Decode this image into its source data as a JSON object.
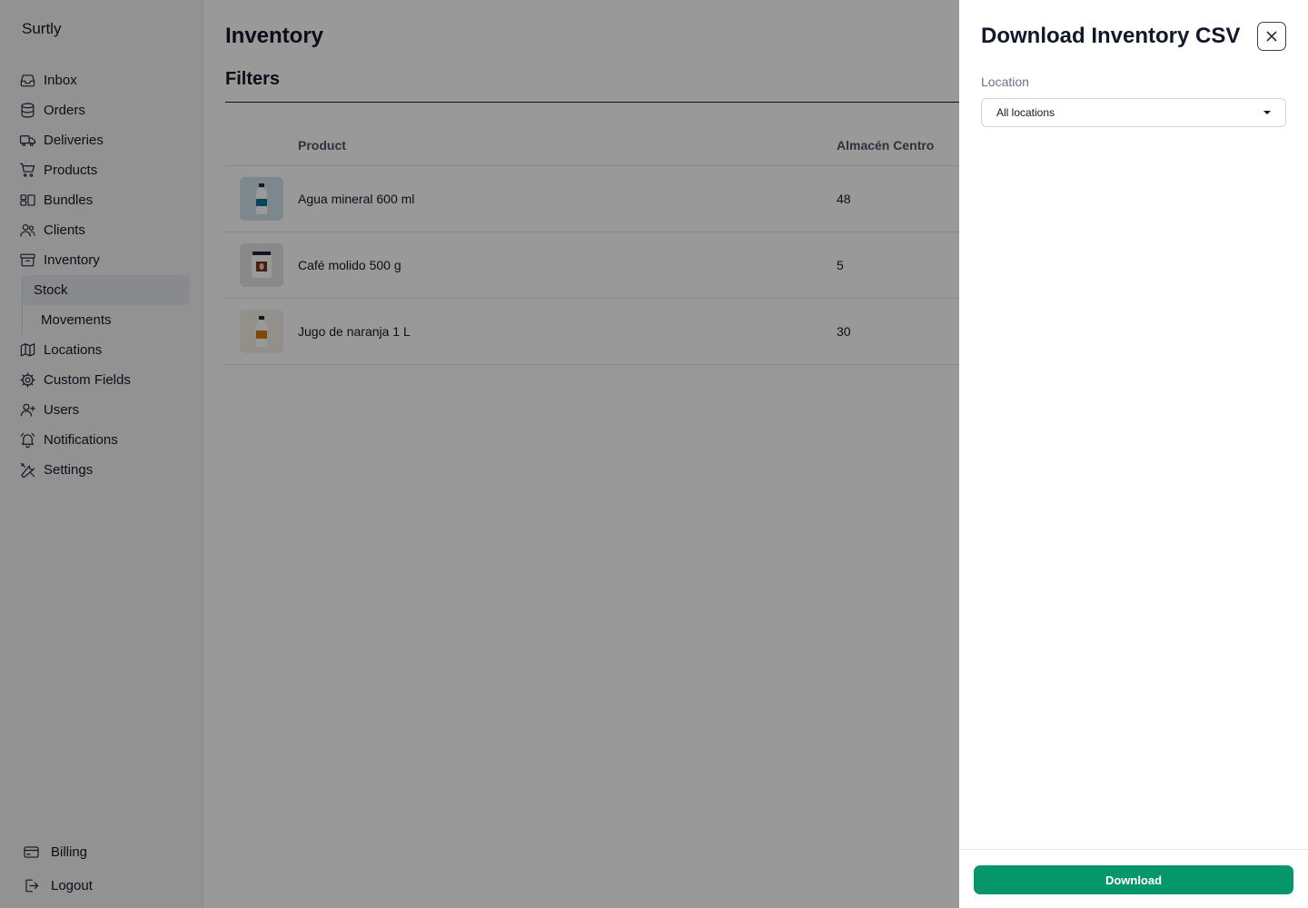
{
  "app": {
    "brand": "Surtly"
  },
  "sidebar": {
    "items": [
      {
        "label": "Inbox",
        "icon": "inbox-icon"
      },
      {
        "label": "Orders",
        "icon": "database-icon"
      },
      {
        "label": "Deliveries",
        "icon": "truck-icon"
      },
      {
        "label": "Products",
        "icon": "cart-icon"
      },
      {
        "label": "Bundles",
        "icon": "bundles-icon"
      },
      {
        "label": "Clients",
        "icon": "users-icon"
      },
      {
        "label": "Inventory",
        "icon": "archive-icon"
      }
    ],
    "subitems": [
      {
        "label": "Stock",
        "active": true
      },
      {
        "label": "Movements",
        "active": false
      }
    ],
    "items_after": [
      {
        "label": "Locations",
        "icon": "map-icon"
      },
      {
        "label": "Custom Fields",
        "icon": "cog-icon"
      },
      {
        "label": "Users",
        "icon": "user-plus-icon"
      },
      {
        "label": "Notifications",
        "icon": "bell-icon"
      },
      {
        "label": "Settings",
        "icon": "wrench-screwdriver-icon"
      }
    ],
    "bottom": [
      {
        "label": "Billing",
        "icon": "credit-card-icon"
      },
      {
        "label": "Logout",
        "icon": "logout-icon"
      }
    ]
  },
  "main": {
    "title": "Inventory",
    "filters_title": "Filters",
    "table": {
      "headers": [
        "",
        "Product",
        "Almacén Centro"
      ],
      "rows": [
        {
          "product": "Agua mineral 600 ml",
          "qty": "48",
          "thumb_bg": "#cfe3ea",
          "label_color": "#0e7490"
        },
        {
          "product": "Café molido 500 g",
          "qty": "5",
          "thumb_bg": "#e7e5e4",
          "label_color": "#78350f"
        },
        {
          "product": "Jugo de naranja 1 L",
          "qty": "30",
          "thumb_bg": "#f5efe6",
          "label_color": "#d97706"
        }
      ]
    }
  },
  "drawer": {
    "title": "Download Inventory CSV",
    "location_label": "Location",
    "location_value": "All locations",
    "download_label": "Download"
  },
  "colors": {
    "accent": "#059669",
    "overlay": "rgba(0,0,0,0.4)"
  }
}
